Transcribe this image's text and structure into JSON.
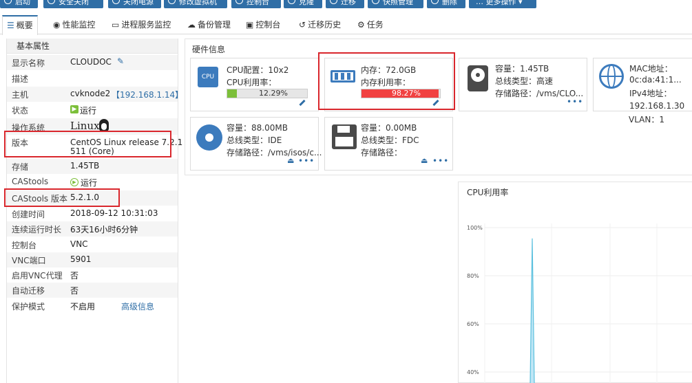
{
  "toolbar": {
    "buttons": [
      {
        "label": "启动",
        "icon": "power-icon"
      },
      {
        "label": "安全关闭",
        "icon": "shutdown-icon"
      },
      {
        "label": "关闭电源",
        "icon": "plug-icon"
      },
      {
        "label": "修改虚拟机",
        "icon": "edit-icon"
      },
      {
        "label": "控制台",
        "icon": "console-icon"
      },
      {
        "label": "克隆",
        "icon": "clone-icon"
      },
      {
        "label": "迁移",
        "icon": "migrate-icon"
      },
      {
        "label": "快照管理",
        "icon": "snapshot-icon"
      },
      {
        "label": "删除",
        "icon": "delete-icon"
      },
      {
        "label": "… 更多操作 ▾",
        "icon": ""
      }
    ]
  },
  "tabs": [
    {
      "label": "概要",
      "icon": "list-icon",
      "active": true
    },
    {
      "label": "性能监控",
      "icon": "monitor-icon"
    },
    {
      "label": "进程服务监控",
      "icon": "process-icon"
    },
    {
      "label": "备份管理",
      "icon": "cloud-icon"
    },
    {
      "label": "控制台",
      "icon": "console-icon"
    },
    {
      "label": "迁移历史",
      "icon": "history-icon"
    },
    {
      "label": "任务",
      "icon": "gear-icon"
    }
  ],
  "properties": {
    "title": "基本属性",
    "display_name_key": "显示名称",
    "display_name": "CLOUDOC",
    "desc_key": "描述",
    "desc": "",
    "host_key": "主机",
    "host_name": "cvknode2",
    "host_ip": "【192.168.1.14】",
    "state_key": "状态",
    "state": "运行",
    "os_key": "操作系统",
    "os_logo": "Linux",
    "version_key": "版本",
    "version_line1": "CentOS Linux release 7.2.1",
    "version_line2": "511 (Core)",
    "storage_key": "存储",
    "storage": "1.45TB",
    "castools_key": "CAStools",
    "castools": "运行",
    "castools_ver_key": "CAStools 版本",
    "castools_ver": "5.2.1.0",
    "created_key": "创建时间",
    "created": "2018-09-12 10:31:03",
    "uptime_key": "连续运行时长",
    "uptime": "63天16小时6分钟",
    "console_key": "控制台",
    "console": "VNC",
    "vncport_key": "VNC端口",
    "vncport": "5901",
    "vncproxy_key": "启用VNC代理",
    "vncproxy": "否",
    "automigrate_key": "自动迁移",
    "automigrate": "否",
    "protect_key": "保护模式",
    "protect": "不启用",
    "advanced": "高级信息"
  },
  "hardware": {
    "title": "硬件信息",
    "cpu": {
      "config": "CPU配置：10x2",
      "usage_label": "CPU利用率：",
      "usage_pct": "12.29%",
      "usage": 12.29,
      "icon_text": "CPU"
    },
    "mem": {
      "size": "内存：72.0GB",
      "usage_label": "内存利用率：",
      "usage_pct": "98.27%",
      "usage": 98.27
    },
    "disk": {
      "cap": "容量：1.45TB",
      "bus": "总线类型：高速",
      "path": "存储路径：/vms/CLO..."
    },
    "net": {
      "mac_label": "MAC地址：",
      "mac": "0c:da:41:1...",
      "ipv4_label": "IPv4地址：",
      "ipv4": "192.168.1.30",
      "vlan": "VLAN：1"
    },
    "cdrom": {
      "cap": "容量：88.00MB",
      "bus": "总线类型：IDE",
      "path": "存储路径：/vms/isos/c..."
    },
    "floppy": {
      "cap": "容量：0.00MB",
      "bus": "总线类型：FDC",
      "path": "存储路径："
    },
    "dots": "•••"
  },
  "chart_data": {
    "type": "line",
    "title": "CPU利用率",
    "yticks": [
      "100%",
      "80%",
      "60%",
      "40%"
    ],
    "ylim": [
      40,
      100
    ],
    "series": [
      {
        "values": [
          0,
          0,
          0,
          95.5,
          0,
          0,
          0,
          0
        ]
      }
    ],
    "line_color": "#5bc0de"
  }
}
